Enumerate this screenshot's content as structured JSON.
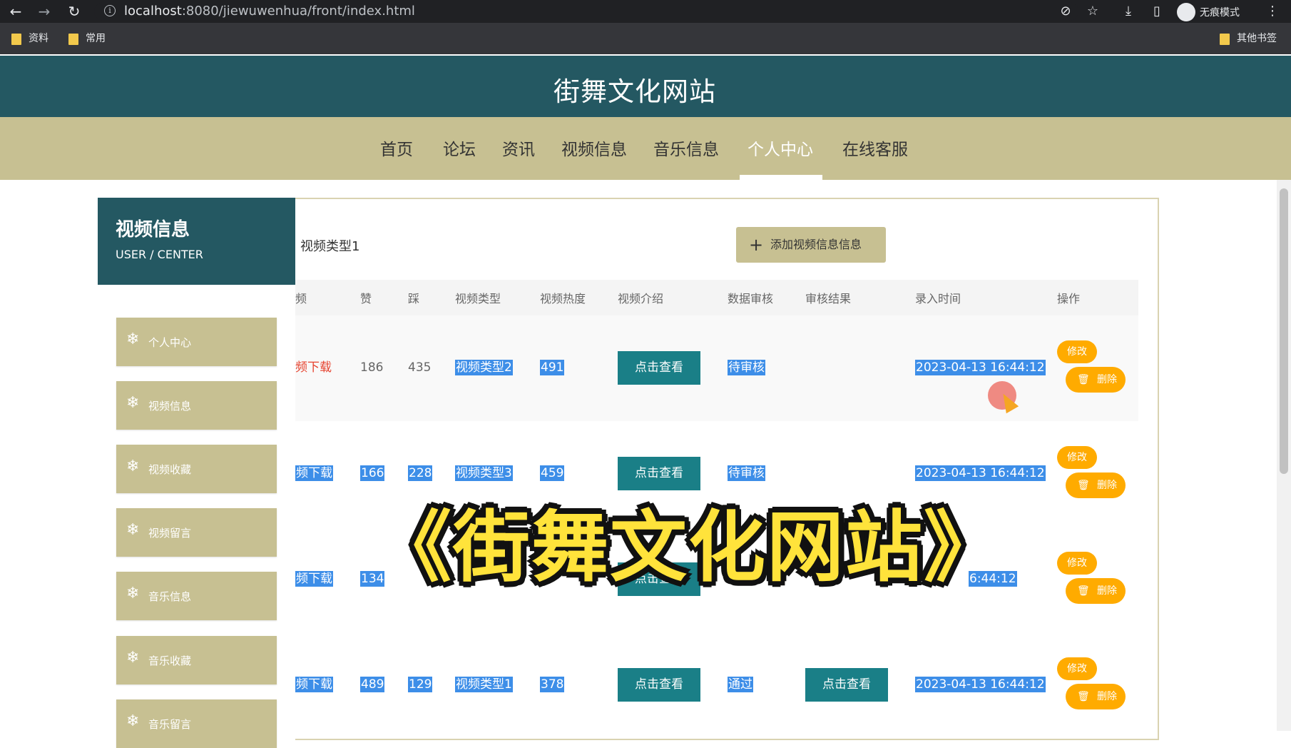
{
  "browser": {
    "url_host": "localhost",
    "url_rest": ":8080/jiewuwenhua/front/index.html",
    "incognito_label": "无痕模式",
    "bookmarks": [
      "资料",
      "常用"
    ],
    "other_bookmarks": "其他书签"
  },
  "site": {
    "title": "街舞文化网站",
    "nav": [
      "首页",
      "论坛",
      "资讯",
      "视频信息",
      "音乐信息",
      "个人中心",
      "在线客服"
    ],
    "active_nav": "个人中心"
  },
  "sidebar": {
    "title": "视频信息",
    "subtitle": "USER / CENTER",
    "items": [
      "个人中心",
      "视频信息",
      "视频收藏",
      "视频留言",
      "音乐信息",
      "音乐收藏",
      "音乐留言"
    ]
  },
  "content": {
    "type_label": "视频类型1",
    "add_button": "添加视频信息信息",
    "headers": [
      "频",
      "赞",
      "踩",
      "视频类型",
      "视频热度",
      "视频介绍",
      "数据审核",
      "审核结果",
      "录入时间",
      "操作"
    ],
    "view_label": "点击查看",
    "edit_label": "修改",
    "delete_label": "删除",
    "rows": [
      {
        "download": "频下载",
        "like": "186",
        "dislike": "435",
        "type": "视频类型2",
        "heat": "491",
        "review": "待审核",
        "time": "2023-04-13 16:44:12"
      },
      {
        "download": "频下载",
        "like": "166",
        "dislike": "228",
        "type": "视频类型3",
        "heat": "459",
        "review": "待审核",
        "time": "2023-04-13 16:44:12"
      },
      {
        "download": "频下载",
        "like": "134",
        "time": "6:44:12"
      },
      {
        "download": "频下载",
        "like": "489",
        "dislike": "129",
        "type": "视频类型1",
        "heat": "378",
        "review": "通过",
        "time": "2023-04-13 16:44:12"
      }
    ]
  },
  "overlay": {
    "title": "《街舞文化网站》"
  },
  "colors": {
    "header": "#245862",
    "nav": "#c7c092",
    "view_button": "#1a7f87",
    "action_button": "#ffab00",
    "overlay_text": "#ffe33b"
  }
}
